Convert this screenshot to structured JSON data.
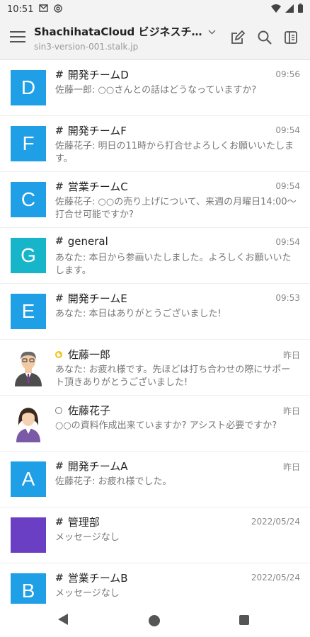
{
  "status_bar": {
    "time": "10:51",
    "icons": [
      "mail-icon",
      "at-sign-icon",
      "wifi-icon",
      "signal-icon",
      "battery-icon"
    ]
  },
  "header": {
    "title": "ShachihataCloud ビジネスチ…",
    "subtitle": "sin3-version-001.stalk.jp",
    "icons": [
      "hamburger-menu-icon",
      "chevron-down-icon",
      "compose-icon",
      "search-icon",
      "panel-icon"
    ]
  },
  "colors": {
    "blue": "#1e9fe6",
    "teal": "#17b5c9",
    "purple": "#6a3fc3",
    "away": "#f2c21b"
  },
  "conversations": [
    {
      "type": "channel",
      "avatar_letter": "D",
      "avatar_color": "#1e9fe6",
      "name": "開発チームD",
      "time": "09:56",
      "preview": "佐藤一郎: ○○さんとの話はどうなっていますか?"
    },
    {
      "type": "channel",
      "avatar_letter": "F",
      "avatar_color": "#1e9fe6",
      "name": "開発チームF",
      "time": "09:54",
      "preview": "佐藤花子: 明日の11時から打合せよろしくお願いいたします。"
    },
    {
      "type": "channel",
      "avatar_letter": "C",
      "avatar_color": "#1e9fe6",
      "name": "営業チームC",
      "time": "09:54",
      "preview": "佐藤花子: ○○の売り上げについて、来週の月曜日14:00～打合せ可能ですか?"
    },
    {
      "type": "channel",
      "avatar_letter": "G",
      "avatar_color": "#17b5c9",
      "name": "general",
      "time": "09:54",
      "preview": "あなた: 本日から参画いたしました。よろしくお願いいたします。"
    },
    {
      "type": "channel",
      "avatar_letter": "E",
      "avatar_color": "#1e9fe6",
      "name": "開発チームE",
      "time": "09:53",
      "preview": "あなた: 本日はありがとうございました!"
    },
    {
      "type": "person",
      "avatar_kind": "man",
      "status": "away",
      "name": "佐藤一郎",
      "time": "昨日",
      "preview": "あなた: お疲れ様です。先ほどは打ち合わせの際にサポート頂きありがとうございました!"
    },
    {
      "type": "person",
      "avatar_kind": "woman",
      "status": "offline",
      "name": "佐藤花子",
      "time": "昨日",
      "preview": "○○の資料作成出来ていますか? アシスト必要ですか?"
    },
    {
      "type": "channel",
      "avatar_letter": "A",
      "avatar_color": "#1e9fe6",
      "name": "開発チームA",
      "time": "昨日",
      "preview": "佐藤花子: お疲れ様でした。"
    },
    {
      "type": "channel",
      "avatar_letter": "",
      "avatar_color": "#6a3fc3",
      "name": "管理部",
      "time": "2022/05/24",
      "preview": "メッセージなし"
    },
    {
      "type": "channel",
      "avatar_letter": "B",
      "avatar_color": "#1e9fe6",
      "name": "営業チームB",
      "time": "2022/05/24",
      "preview": "メッセージなし"
    }
  ]
}
